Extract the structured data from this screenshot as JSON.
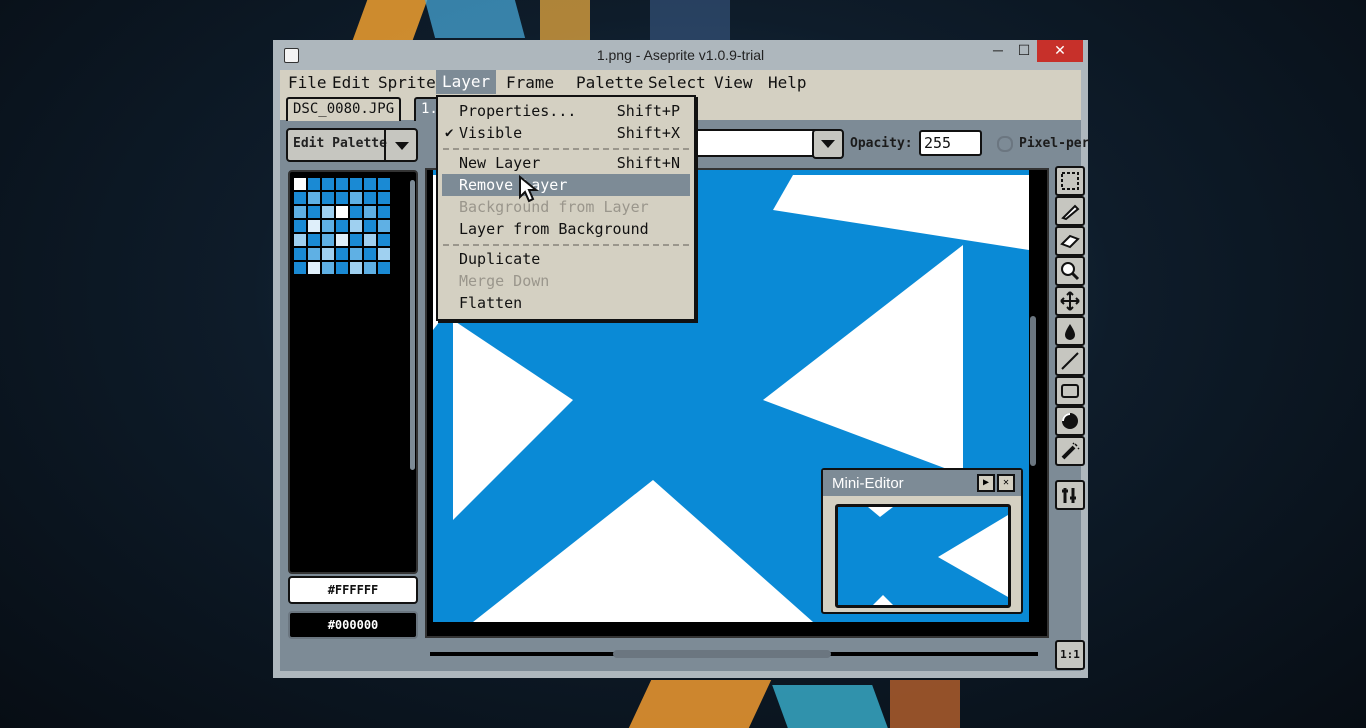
{
  "window": {
    "title": "1.png - Aseprite v1.0.9-trial",
    "controls": {
      "minimize": "─",
      "maximize": "☐",
      "close": "✕"
    }
  },
  "menubar": {
    "items": [
      {
        "label": "File"
      },
      {
        "label": "Edit"
      },
      {
        "label": "Sprite"
      },
      {
        "label": "Layer"
      },
      {
        "label": "Frame"
      },
      {
        "label": "Palette"
      },
      {
        "label": "Select"
      },
      {
        "label": "View"
      },
      {
        "label": "Help"
      }
    ],
    "active": "Layer"
  },
  "tabs": [
    {
      "label": "DSC_0080.JPG"
    },
    {
      "label": "1.png"
    }
  ],
  "toolbar": {
    "edit_palette_label": "Edit Palette",
    "opacity_label": "Opacity:",
    "opacity_value": "255",
    "pixel_perfect_label": "Pixel-per"
  },
  "palette": {
    "colors": [
      "#ffffff",
      "#1a8ad4",
      "#1a8ad4",
      "#1a8ad4",
      "#1a8ad4",
      "#1a8ad4",
      "#1a8ad4",
      "#1a8ad4",
      "#5fb0e4",
      "#1a8ad4",
      "#1a8ad4",
      "#5fb0e4",
      "#1a8ad4",
      "#1a8ad4",
      "#5fb0e4",
      "#1a8ad4",
      "#9fd0f0",
      "#ffffff",
      "#1a8ad4",
      "#5fb0e4",
      "#1a8ad4",
      "#1a8ad4",
      "#dfeffa",
      "#5fb0e4",
      "#1a8ad4",
      "#9fd0f0",
      "#1a8ad4",
      "#5fb0e4",
      "#9fd0f0",
      "#1a8ad4",
      "#5fb0e4",
      "#dfeffa",
      "#1a8ad4",
      "#9fd0f0",
      "#1a8ad4",
      "#1a8ad4",
      "#5fb0e4",
      "#9fd0f0",
      "#1a8ad4",
      "#5fb0e4",
      "#1a8ad4",
      "#9fd0f0",
      "#1a8ad4",
      "#dfeffa",
      "#5fb0e4",
      "#1a8ad4",
      "#9fd0f0",
      "#5fb0e4",
      "#1a8ad4"
    ],
    "foreground": "#FFFFFF",
    "background": "#000000"
  },
  "layer_menu": {
    "items": [
      {
        "label": "Properties...",
        "shortcut": "Shift+P",
        "enabled": true
      },
      {
        "label": "Visible",
        "shortcut": "Shift+X",
        "enabled": true,
        "checked": true
      },
      {
        "label": "New Layer",
        "shortcut": "Shift+N",
        "enabled": true
      },
      {
        "label": "Remove Layer",
        "shortcut": "",
        "enabled": true,
        "highlighted": true
      },
      {
        "label": "Background from Layer",
        "shortcut": "",
        "enabled": false
      },
      {
        "label": "Layer from Background",
        "shortcut": "",
        "enabled": true
      },
      {
        "label": "Duplicate",
        "shortcut": "",
        "enabled": true
      },
      {
        "label": "Merge Down",
        "shortcut": "",
        "enabled": false
      },
      {
        "label": "Flatten",
        "shortcut": "",
        "enabled": true
      }
    ]
  },
  "mini_editor": {
    "title": "Mini-Editor"
  },
  "tools": [
    "marquee-icon",
    "pencil-icon",
    "eraser-icon",
    "zoom-icon",
    "move-icon",
    "fill-icon",
    "line-icon",
    "rectangle-icon",
    "ellipse-icon",
    "spray-icon",
    "configure-icon"
  ],
  "zoom_reset": "1:1",
  "colors": {
    "canvas_blue": "#0a8ad6",
    "ui_gray": "#7d8b96",
    "menu_bg": "#d4d0c2",
    "close_red": "#c7302a"
  }
}
